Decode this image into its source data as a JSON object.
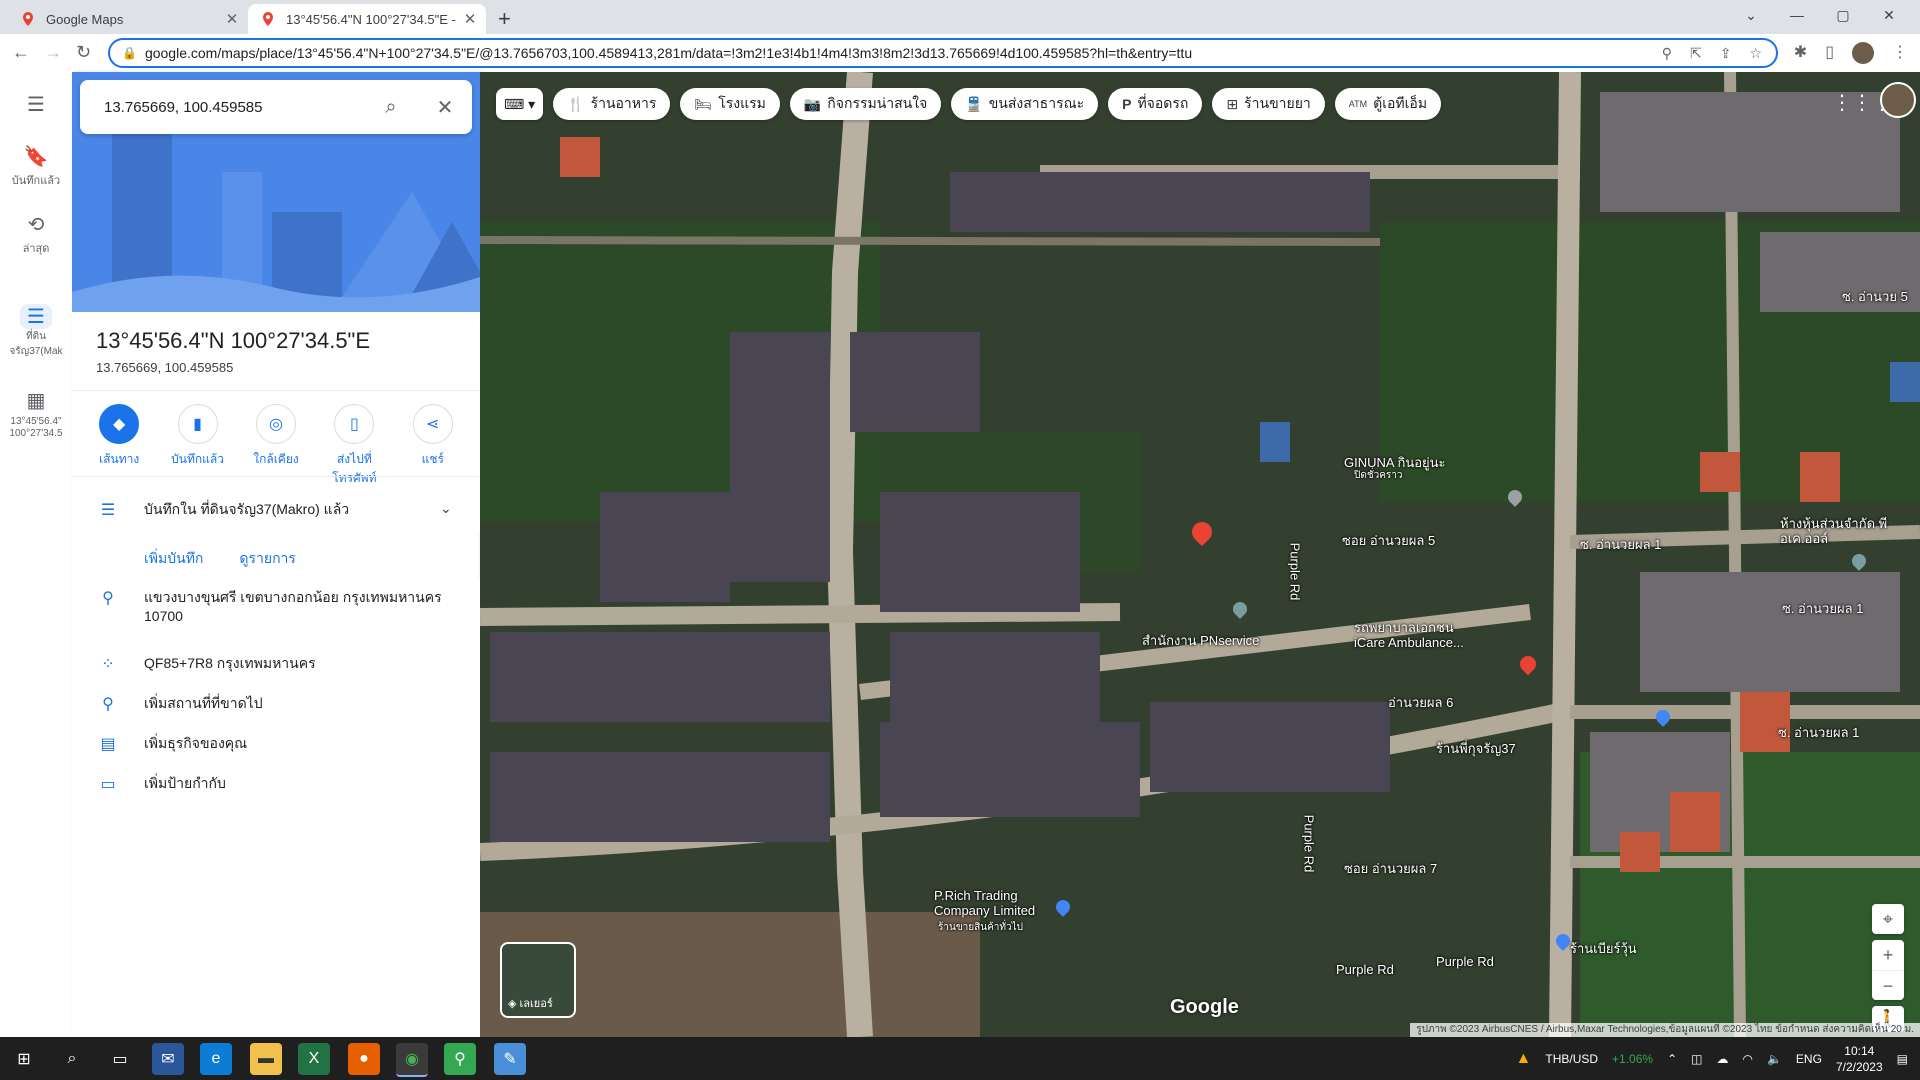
{
  "browser": {
    "tabs": [
      {
        "title": "Google Maps",
        "active": false
      },
      {
        "title": "13°45'56.4\"N 100°27'34.5\"E - Go",
        "active": true
      }
    ],
    "url": "google.com/maps/place/13°45'56.4\"N+100°27'34.5\"E/@13.7656703,100.4589413,281m/data=!3m2!1e3!4b1!4m4!3m3!8m2!3d13.765669!4d100.459585?hl=th&entry=ttu"
  },
  "rail": {
    "items": [
      {
        "label": "บันทึกแล้ว",
        "icon": "bookmark-icon"
      },
      {
        "label": "ล่าสุด",
        "icon": "history-icon"
      },
      {
        "label": "ที่ดินจรัญ37(Mak",
        "icon": "list-icon"
      },
      {
        "label": "13°45'56.4\" 100°27'34.5",
        "icon": "thumbnail-icon"
      }
    ]
  },
  "search": {
    "value": "13.765669, 100.459585"
  },
  "place": {
    "title": "13°45'56.4\"N 100°27'34.5\"E",
    "coords": "13.765669, 100.459585"
  },
  "actions": [
    {
      "label": "เส้นทาง",
      "icon": "directions-icon"
    },
    {
      "label": "บันทึกแล้ว",
      "icon": "bookmark-icon"
    },
    {
      "label": "ใกล้เคียง",
      "icon": "nearby-icon"
    },
    {
      "label": "ส่งไปที่โทรศัพท์",
      "icon": "send-to-phone-icon"
    },
    {
      "label": "แชร์",
      "icon": "share-icon"
    }
  ],
  "saved": {
    "text": "บันทึกใน ที่ดินจรัญ37(Makro) แล้ว",
    "add_note": "เพิ่มบันทึก",
    "view_list": "ดูรายการ"
  },
  "details": {
    "address": "แขวงบางขุนศรี เขตบางกอกน้อย กรุงเทพมหานคร 10700",
    "plus_code": "QF85+7R8 กรุงเทพมหานคร",
    "add_missing": "เพิ่มสถานที่ที่ขาดไป",
    "add_business": "เพิ่มธุรกิจของคุณ",
    "add_label": "เพิ่มป้ายกำกับ"
  },
  "map": {
    "chips": [
      {
        "label": "ร้านอาหาร",
        "icon": "restaurant-icon"
      },
      {
        "label": "โรงแรม",
        "icon": "hotel-icon"
      },
      {
        "label": "กิจกรรมน่าสนใจ",
        "icon": "camera-icon"
      },
      {
        "label": "ขนส่งสาธารณะ",
        "icon": "transit-icon"
      },
      {
        "label": "ที่จอดรถ",
        "icon": "parking-icon"
      },
      {
        "label": "ร้านขายยา",
        "icon": "pharmacy-icon"
      },
      {
        "label": "ตู้เอทีเอ็ม",
        "icon": "atm-icon"
      }
    ],
    "labels": {
      "ginuna": "GINUNA กินอยู่นะ",
      "ginuna_sub": "ปิดชั่วคราว",
      "soi5": "ซอย อ่านวยผล 5",
      "soi_amnuay1": "ซ. อ่านวยผล 1",
      "soi_amnuay1b": "ซ. อ่านวยผล 1",
      "amnuay6": "อ่านวยผล 6",
      "soi7": "ซอย อ่านวยผล 7",
      "office": "สำนักงาน PNservice",
      "hospital": "รถพยาบาลเอกชน iCare Ambulance...",
      "shop37": "ร้านพี่กุจรัญ37",
      "purple1": "Purple Rd",
      "purple2": "Purple Rd",
      "purple3": "Purple Rd",
      "purple4": "Purple Rd",
      "prich": "P.Rich Trading Company Limited",
      "prich_sub": "ร้านขายสินค้าทั่วไป",
      "beer": "ร้านเบียร์วุ้น",
      "dept": "ห้างหุ้นส่วนจำกัด พีอเค.ออล์",
      "soi5b": "ซ. อ่านวย 5",
      "layers": "เลเยอร์",
      "google": "Google",
      "attrib": "รูปภาพ ©2023 AirbusCNES / Airbus,Maxar Technologies,ข้อมูลแผนที่ ©2023   ไทย   ข้อกำหนด   ส่งความคิดเห็น   20 ม."
    }
  },
  "taskbar": {
    "currency": "THB/USD",
    "change": "+1.06%",
    "lang": "ENG",
    "time": "10:14",
    "date": "7/2/2023"
  }
}
